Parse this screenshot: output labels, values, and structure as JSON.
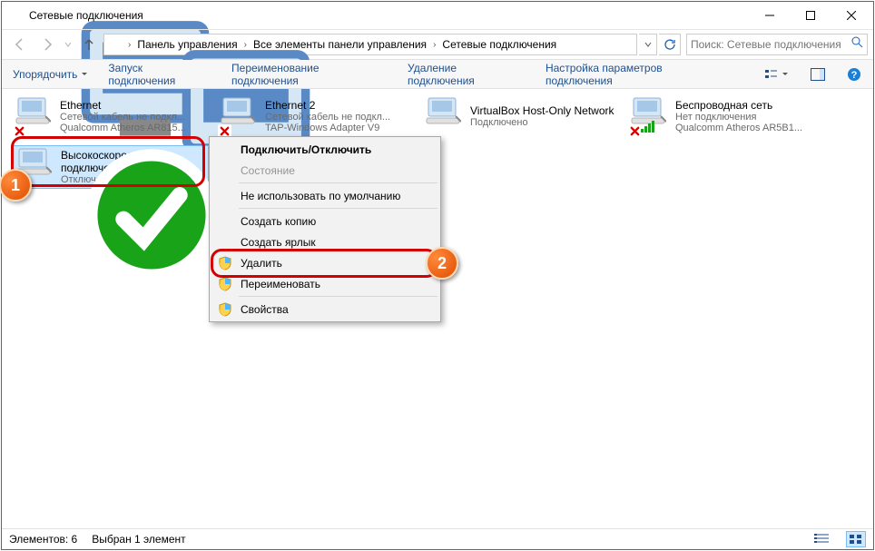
{
  "title": "Сетевые подключения",
  "breadcrumb": {
    "b1": "Панель управления",
    "b2": "Все элементы панели управления",
    "b3": "Сетевые подключения"
  },
  "search": {
    "placeholder": "Поиск: Сетевые подключения"
  },
  "toolbar": {
    "organize": "Упорядочить",
    "start": "Запуск подключения",
    "rename": "Переименование подключения",
    "delete": "Удаление подключения",
    "settings": "Настройка параметров подключения"
  },
  "items": {
    "ethernet": {
      "name": "Ethernet",
      "sub1": "Сетевой кабель не подкл...",
      "sub2": "Qualcomm Atheros AR815..."
    },
    "ethernet2": {
      "name": "Ethernet 2",
      "sub1": "Сетевой кабель не подкл...",
      "sub2": "TAP-Windows Adapter V9"
    },
    "vbox": {
      "name": "VirtualBox Host-Only Network",
      "sub1": "Подключено",
      "sub2": ""
    },
    "wifi": {
      "name": "Беспроводная сеть",
      "sub1": "Нет подключения",
      "sub2": "Qualcomm Atheros AR5B1..."
    },
    "pppoe": {
      "name": "Высокоскоростное подключение",
      "sub1": "Отключено",
      "sub2": ""
    }
  },
  "ctx": {
    "connect": "Подключить/Отключить",
    "status": "Состояние",
    "default": "Не использовать по умолчанию",
    "copy": "Создать копию",
    "shortcut": "Создать ярлык",
    "delete": "Удалить",
    "rename": "Переименовать",
    "props": "Свойства"
  },
  "status": {
    "count": "Элементов: 6",
    "selected": "Выбран 1 элемент"
  },
  "callouts": {
    "n1": "1",
    "n2": "2"
  }
}
